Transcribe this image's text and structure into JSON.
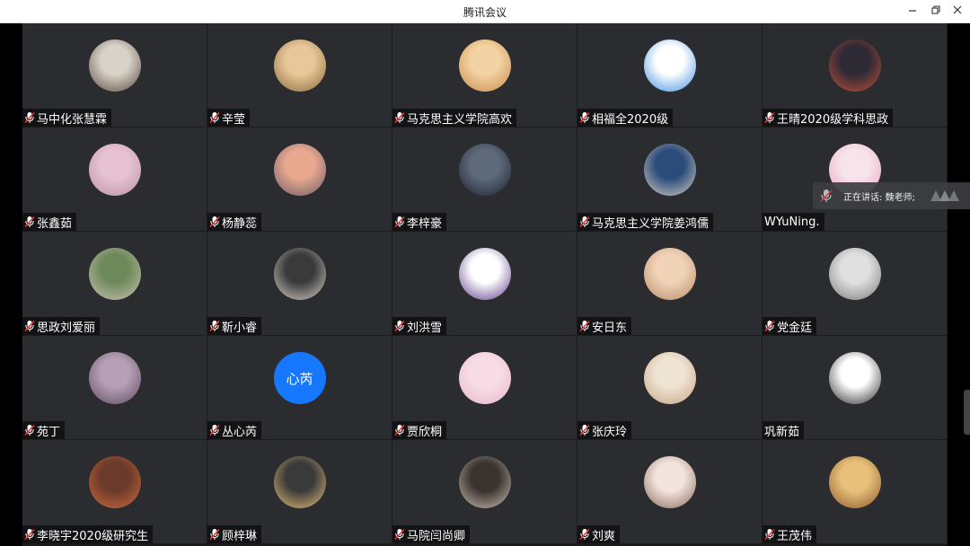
{
  "window": {
    "title": "腾讯会议",
    "minimize_icon": "minimize-icon",
    "maximize_icon": "restore-icon",
    "close_icon": "close-icon"
  },
  "speaking": {
    "label": "正在讲话: 魏老师;"
  },
  "colors": {
    "tile_bg": "#2b2c30",
    "grid_line": "#1a1b1e",
    "text_avatar": "#1677ff",
    "mic_muted": "#e53935"
  },
  "participants": [
    {
      "name": "马中化张慧霖",
      "muted": true
    },
    {
      "name": "辛莹",
      "muted": true
    },
    {
      "name": "马克思主义学院高欢",
      "muted": true
    },
    {
      "name": "相福全2020级",
      "muted": true
    },
    {
      "name": "王晴2020级学科思政",
      "muted": true
    },
    {
      "name": "张鑫茹",
      "muted": true
    },
    {
      "name": "杨静蕊",
      "muted": true
    },
    {
      "name": "李梓豪",
      "muted": true
    },
    {
      "name": "马克思主义学院姜鸿儒",
      "muted": true
    },
    {
      "name": "WYuNing.",
      "muted": false
    },
    {
      "name": "思政刘爱丽",
      "muted": true
    },
    {
      "name": "靳小睿",
      "muted": true
    },
    {
      "name": "刘洪雪",
      "muted": true
    },
    {
      "name": "安日东",
      "muted": true
    },
    {
      "name": "党金廷",
      "muted": true
    },
    {
      "name": "苑丁",
      "muted": true
    },
    {
      "name": "丛心芮",
      "muted": true,
      "avatar_text": "心芮"
    },
    {
      "name": "贾欣桐",
      "muted": true
    },
    {
      "name": "张庆玲",
      "muted": true
    },
    {
      "name": "巩新茹",
      "muted": false
    },
    {
      "name": "李晓宇2020级研究生",
      "muted": true
    },
    {
      "name": "顾梓琳",
      "muted": true
    },
    {
      "name": "马院闫尚卿",
      "muted": true
    },
    {
      "name": "刘爽",
      "muted": true
    },
    {
      "name": "王茂伟",
      "muted": true
    }
  ]
}
